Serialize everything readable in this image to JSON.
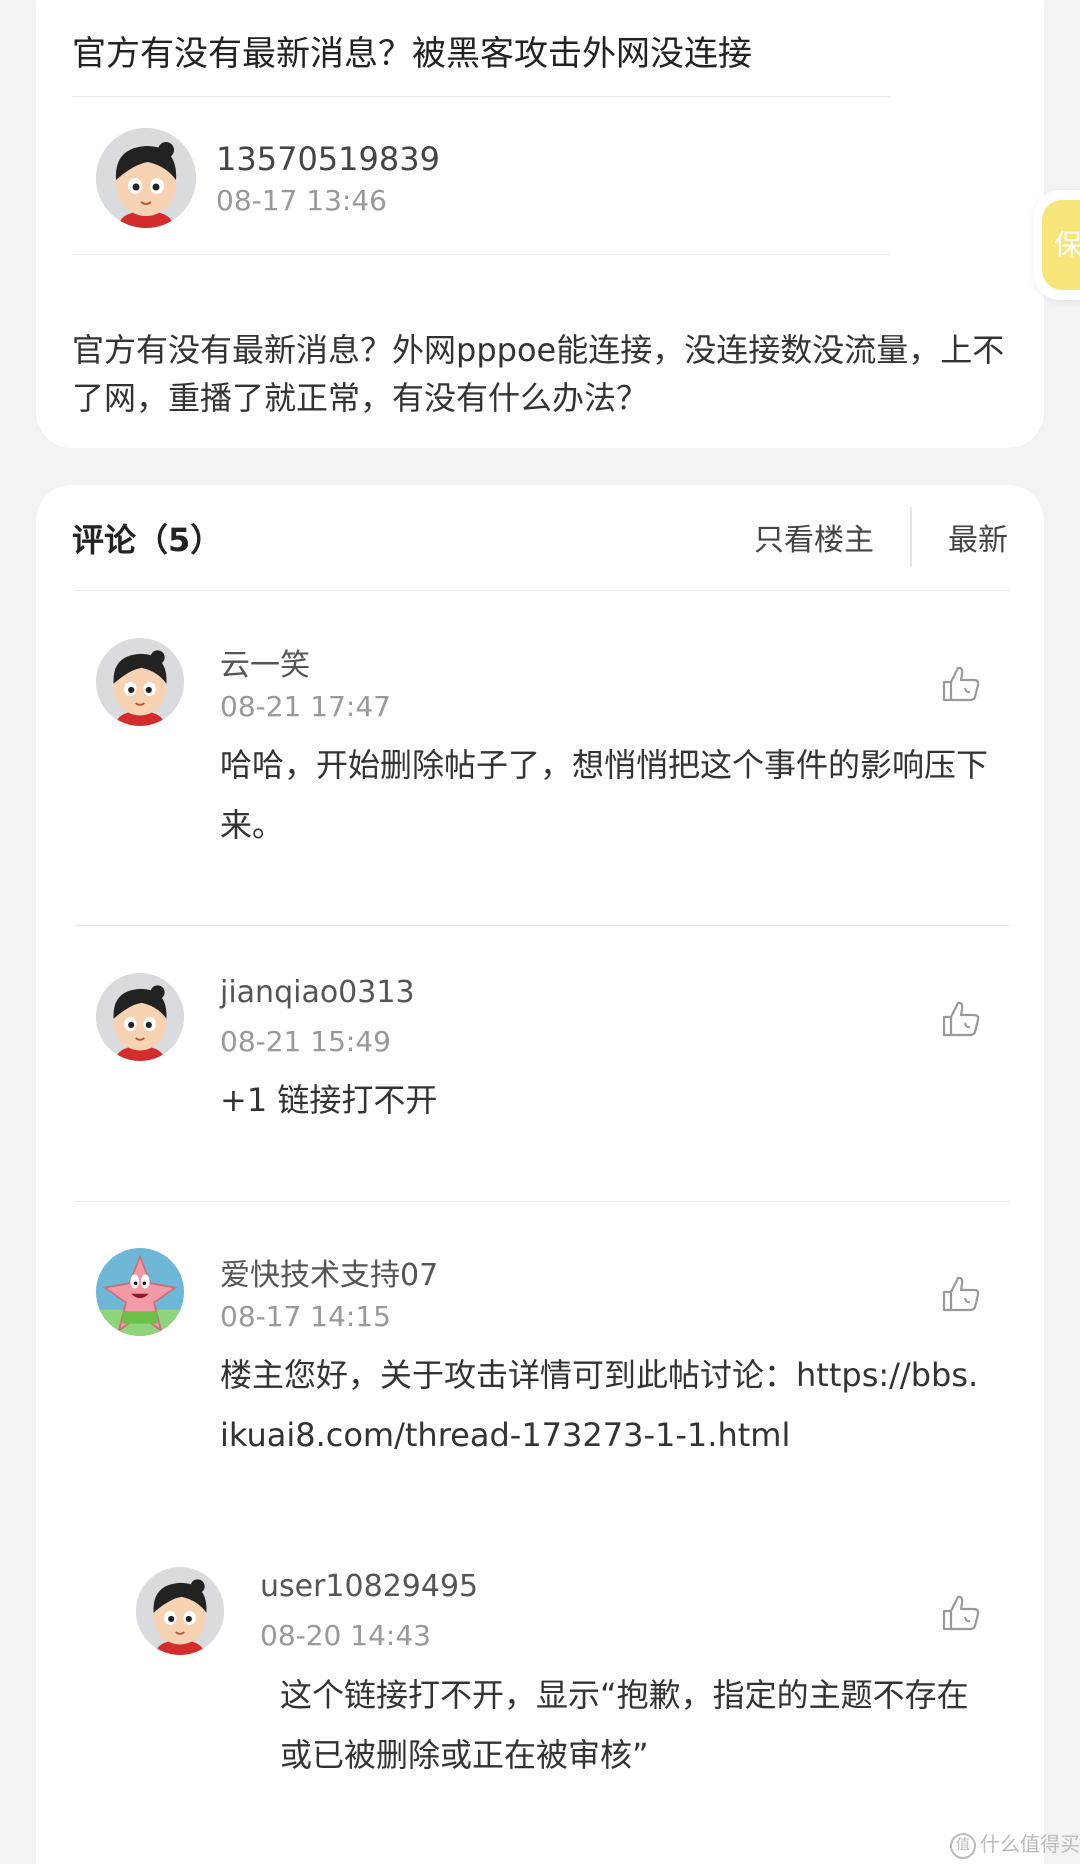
{
  "post": {
    "title": "官方有没有最新消息？被黑客攻击外网没连接",
    "author": "13570519839",
    "time": "08-17  13:46",
    "body": "官方有没有最新消息？外网pppoe能连接，没连接数没流量，上不了网，重播了就正常，有没有什么办法？",
    "avatar_icon": "cartoon-boy-avatar"
  },
  "comments_header": {
    "title": "评论（5）",
    "only_op": "只看楼主",
    "latest": "最新"
  },
  "comments": [
    {
      "name": "云一笑",
      "time": "08-21  17:47",
      "text": "哈哈，开始删除帖子了，想悄悄把这个事件的影响压下来。",
      "avatar_icon": "cartoon-boy-avatar",
      "like_icon": "thumbs-up-icon"
    },
    {
      "name": "jianqiao0313",
      "time": "08-21  15:49",
      "text": "+1  链接打不开",
      "avatar_icon": "cartoon-boy-avatar",
      "like_icon": "thumbs-up-icon"
    },
    {
      "name": "爱快技术支持07",
      "time": "08-17  14:15",
      "text": "楼主您好，关于攻击详情可到此帖讨论：https://bbs.ikuai8.com/thread-173273-1-1.html",
      "avatar_icon": "patrick-star-avatar",
      "like_icon": "thumbs-up-icon"
    }
  ],
  "reply": {
    "name": "user10829495",
    "time": "08-20  14:43",
    "text": "这个链接打不开，显示“抱歉，指定的主题不存在或已被删除或正在被审核”",
    "avatar_icon": "cartoon-boy-avatar",
    "like_icon": "thumbs-up-icon"
  },
  "side_tab": {
    "label": "保"
  },
  "watermark": {
    "text": "什么值得买"
  },
  "colors": {
    "page_bg": "#f3f3f6",
    "card_bg": "#ffffff",
    "side_tab": "#f8e57a"
  }
}
